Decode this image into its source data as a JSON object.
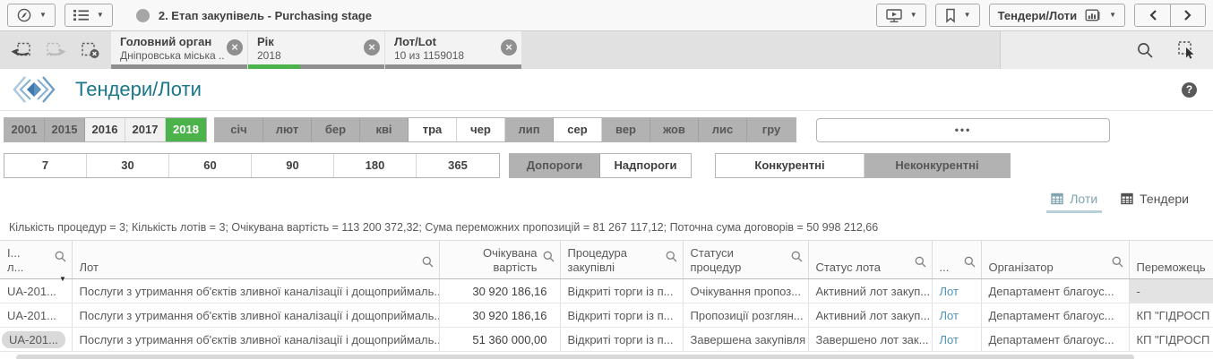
{
  "glyphs": {
    "caret": "▼",
    "close": "×",
    "help": "?",
    "sort_desc": "▼"
  },
  "colors": {
    "selected_green": "#4cb34c",
    "excluded_grey": "#b2b2b2",
    "sheet_title_teal": "#1a768a",
    "link_blue": "#4f93b8",
    "selection_bar_grey": "#8f8f8f"
  },
  "topbar": {
    "title": "2. Етап закупівель - Purchasing stage",
    "sheet_selector_label": "Тендери/Лоти"
  },
  "selections_bar": {
    "chips": [
      {
        "field": "Головний орган",
        "value": "Дніпровська міська ...",
        "green_pct": 0
      },
      {
        "field": "Рік",
        "value": "2018",
        "green_pct": 38
      },
      {
        "field": "Лот/Lot",
        "value": "10 из 1159018",
        "green_pct": 0
      }
    ]
  },
  "sheet_header": {
    "title": "Тендери/Лоти"
  },
  "filters": {
    "years": [
      {
        "label": "2001",
        "state": "excluded"
      },
      {
        "label": "2015",
        "state": "excluded"
      },
      {
        "label": "2016",
        "state": "alternative"
      },
      {
        "label": "2017",
        "state": "alternative"
      },
      {
        "label": "2018",
        "state": "selected"
      }
    ],
    "months": [
      {
        "label": "січ",
        "state": "excluded"
      },
      {
        "label": "лют",
        "state": "excluded"
      },
      {
        "label": "бер",
        "state": "excluded"
      },
      {
        "label": "кві",
        "state": "excluded"
      },
      {
        "label": "тра",
        "state": "possible"
      },
      {
        "label": "чер",
        "state": "possible"
      },
      {
        "label": "лип",
        "state": "excluded"
      },
      {
        "label": "сер",
        "state": "possible"
      },
      {
        "label": "вер",
        "state": "excluded"
      },
      {
        "label": "жов",
        "state": "excluded"
      },
      {
        "label": "лис",
        "state": "excluded"
      },
      {
        "label": "гру",
        "state": "excluded"
      }
    ],
    "search_box": "•••",
    "periods": [
      {
        "label": "7",
        "state": "possible"
      },
      {
        "label": "30",
        "state": "possible"
      },
      {
        "label": "60",
        "state": "possible"
      },
      {
        "label": "90",
        "state": "possible"
      },
      {
        "label": "180",
        "state": "possible"
      },
      {
        "label": "365",
        "state": "possible"
      }
    ],
    "thresholds": [
      {
        "label": "Допороги",
        "state": "excluded"
      },
      {
        "label": "Надпороги",
        "state": "possible"
      }
    ],
    "competitiveness": [
      {
        "label": "Конкурентні",
        "state": "possible"
      },
      {
        "label": "Неконкурентні",
        "state": "excluded"
      }
    ]
  },
  "view_tabs": [
    {
      "label": "Лоти",
      "active": true
    },
    {
      "label": "Тендери",
      "active": false
    }
  ],
  "summary_line": "Кількість процедур = 3; Кількість лотів = 3; Очікувана вартість = 113 200 372,32; Сума переможних пропозицій = 81 267 117,12; Поточна сума договорів = 50 998 212,66",
  "table": {
    "columns": [
      {
        "line1": "І...",
        "line2": "л..."
      },
      {
        "line1": "Лот",
        "line2": ""
      },
      {
        "line1": "Очікувана",
        "line2": "вартість"
      },
      {
        "line1": "Процедура",
        "line2": "закупівлі"
      },
      {
        "line1": "Статуси",
        "line2": "процедур"
      },
      {
        "line1": "Статус лота",
        "line2": ""
      },
      {
        "line1": "...",
        "line2": ""
      },
      {
        "line1": "Організатор",
        "line2": ""
      },
      {
        "line1": "Переможець",
        "line2": ""
      }
    ],
    "rows": [
      {
        "cells": [
          "UA-201...",
          "Послуги з утримання об'єктів зливної каналізації і дощоприймаль...",
          "30 920 186,16",
          "Відкриті торги із п...",
          "Очікування пропоз...",
          "Активний лот закуп...",
          "Лот",
          "Департамент благоус...",
          "-"
        ]
      },
      {
        "cells": [
          "UA-201...",
          "Послуги з утримання об'єктів зливної каналізації і дощоприймаль...",
          "30 920 186,16",
          "Відкриті торги із п...",
          "Пропозиції розглян...",
          "Активний лот закуп...",
          "Лот",
          "Департамент благоус...",
          "КП \"ГІДРОСП"
        ]
      },
      {
        "cells": [
          "UA-201...",
          "Послуги з утримання об'єктів зливної каналізації і дощоприймаль...",
          "51 360 000,00",
          "Відкриті торги із п...",
          "Завершена закупівля",
          "Завершено лот зак...",
          "Лот",
          "Департамент благоус...",
          "КП \"ГІДРОСП"
        ]
      }
    ]
  }
}
